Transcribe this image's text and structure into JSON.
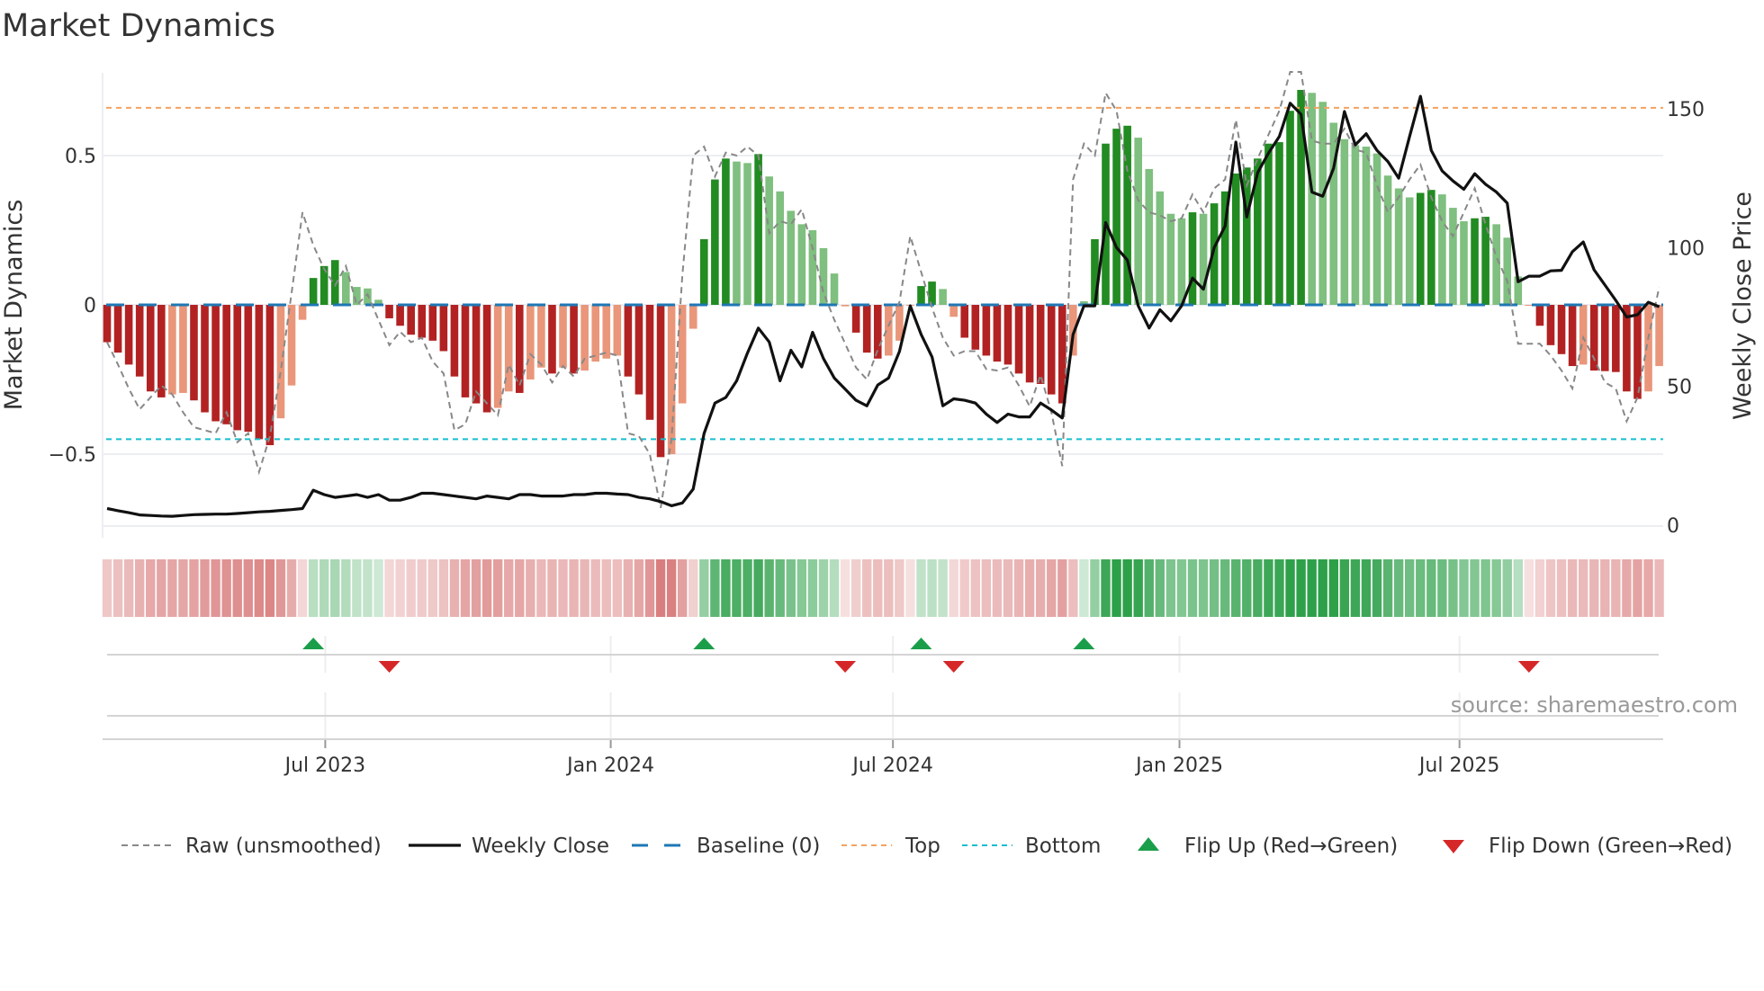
{
  "chart_data": {
    "type": "bar",
    "title": "Market Dynamics",
    "ylabel_left": "Market Dynamics",
    "ylabel_right": "Weekly Close Price",
    "source": "source: sharemaestro.com",
    "ylim_left": [
      -0.75,
      0.78
    ],
    "ylim_right": [
      0,
      160
    ],
    "left_ticks": [
      {
        "value": 0.5,
        "label": "0.5"
      },
      {
        "value": 0,
        "label": "0"
      },
      {
        "value": -0.5,
        "label": "−0.5"
      }
    ],
    "right_ticks": [
      {
        "value": 150,
        "label": "150"
      },
      {
        "value": 100,
        "label": "100"
      },
      {
        "value": 50,
        "label": "50"
      },
      {
        "value": 0,
        "label": "0"
      }
    ],
    "x_ticks": [
      {
        "week": 20.1,
        "label": "Jul 2023"
      },
      {
        "week": 46.4,
        "label": "Jan 2024"
      },
      {
        "week": 72.4,
        "label": "Jul 2024"
      },
      {
        "week": 98.8,
        "label": "Jan 2025"
      },
      {
        "week": 124.6,
        "label": "Jul 2025"
      }
    ],
    "top_level": 0.66,
    "bottom_level": -0.45,
    "baseline": 0,
    "colors": {
      "green_strong": "#228b22",
      "green_weak": "#7fbf7f",
      "red_strong": "#b22222",
      "red_weak": "#e9967a",
      "close": "#111111",
      "raw": "#888888",
      "baseline": "#1f77b4",
      "top": "#f4a261",
      "bottom": "#17becf",
      "flip_up": "#1a9e4a",
      "flip_down": "#d62728"
    },
    "dynamics": [
      -0.125,
      -0.16,
      -0.2,
      -0.24,
      -0.29,
      -0.31,
      -0.3,
      -0.295,
      -0.32,
      -0.36,
      -0.39,
      -0.4,
      -0.42,
      -0.425,
      -0.45,
      -0.47,
      -0.38,
      -0.27,
      -0.05,
      0.09,
      0.13,
      0.15,
      0.11,
      0.06,
      0.055,
      0.017,
      -0.045,
      -0.07,
      -0.1,
      -0.11,
      -0.12,
      -0.155,
      -0.24,
      -0.31,
      -0.33,
      -0.36,
      -0.345,
      -0.29,
      -0.295,
      -0.25,
      -0.21,
      -0.23,
      -0.21,
      -0.23,
      -0.22,
      -0.19,
      -0.18,
      -0.17,
      -0.24,
      -0.3,
      -0.385,
      -0.51,
      -0.5,
      -0.33,
      -0.08,
      0.22,
      0.42,
      0.49,
      0.48,
      0.475,
      0.505,
      0.43,
      0.38,
      0.315,
      0.27,
      0.25,
      0.19,
      0.105,
      -0.005,
      -0.093,
      -0.16,
      -0.18,
      -0.17,
      -0.12,
      -0.003,
      0.063,
      0.078,
      0.053,
      -0.04,
      -0.11,
      -0.15,
      -0.17,
      -0.19,
      -0.2,
      -0.23,
      -0.26,
      -0.265,
      -0.3,
      -0.33,
      -0.17,
      0.012,
      0.22,
      0.54,
      0.59,
      0.6,
      0.56,
      0.455,
      0.38,
      0.305,
      0.29,
      0.31,
      0.305,
      0.34,
      0.38,
      0.44,
      0.46,
      0.49,
      0.54,
      0.545,
      0.65,
      0.72,
      0.71,
      0.68,
      0.61,
      0.555,
      0.535,
      0.53,
      0.507,
      0.433,
      0.39,
      0.36,
      0.375,
      0.385,
      0.37,
      0.325,
      0.28,
      0.29,
      0.295,
      0.27,
      0.225,
      0.095,
      -0.003,
      -0.07,
      -0.135,
      -0.165,
      -0.205,
      -0.2,
      -0.22,
      -0.222,
      -0.225,
      -0.29,
      -0.315,
      -0.29,
      -0.205
    ],
    "raw": [
      -0.125,
      -0.2,
      -0.28,
      -0.35,
      -0.31,
      -0.27,
      -0.3,
      -0.36,
      -0.41,
      -0.42,
      -0.43,
      -0.36,
      -0.46,
      -0.43,
      -0.56,
      -0.44,
      -0.22,
      0.04,
      0.31,
      0.2,
      0.12,
      0.065,
      0.13,
      0.0,
      0.035,
      -0.05,
      -0.135,
      -0.09,
      -0.125,
      -0.11,
      -0.19,
      -0.23,
      -0.42,
      -0.4,
      -0.29,
      -0.33,
      -0.37,
      -0.2,
      -0.27,
      -0.165,
      -0.2,
      -0.26,
      -0.205,
      -0.24,
      -0.18,
      -0.17,
      -0.16,
      -0.17,
      -0.43,
      -0.44,
      -0.5,
      -0.68,
      -0.45,
      0.1,
      0.5,
      0.53,
      0.43,
      0.51,
      0.5,
      0.53,
      0.5,
      0.24,
      0.28,
      0.27,
      0.32,
      0.19,
      0.04,
      -0.05,
      -0.13,
      -0.21,
      -0.25,
      -0.15,
      -0.07,
      0.01,
      0.23,
      0.11,
      -0.01,
      -0.11,
      -0.17,
      -0.155,
      -0.155,
      -0.215,
      -0.22,
      -0.21,
      -0.27,
      -0.34,
      -0.235,
      -0.36,
      -0.54,
      0.42,
      0.54,
      0.5,
      0.71,
      0.65,
      0.45,
      0.35,
      0.31,
      0.3,
      0.28,
      0.29,
      0.37,
      0.31,
      0.39,
      0.42,
      0.62,
      0.4,
      0.49,
      0.57,
      0.65,
      0.78,
      0.79,
      0.55,
      0.54,
      0.54,
      0.59,
      0.52,
      0.51,
      0.4,
      0.31,
      0.36,
      0.42,
      0.47,
      0.36,
      0.28,
      0.23,
      0.31,
      0.39,
      0.27,
      0.16,
      0.08,
      -0.13,
      -0.13,
      -0.13,
      -0.17,
      -0.22,
      -0.28,
      -0.11,
      -0.18,
      -0.26,
      -0.28,
      -0.39,
      -0.31,
      -0.11,
      0.06
    ],
    "close": [
      6,
      5.2,
      4.5,
      3.7,
      3.5,
      3.3,
      3.2,
      3.5,
      3.8,
      3.9,
      4,
      4,
      4.2,
      4.5,
      4.8,
      5,
      5.3,
      5.6,
      6,
      12.6,
      11,
      10,
      10.5,
      11,
      10,
      11,
      9,
      9,
      10,
      11.5,
      11.5,
      11,
      10.5,
      10,
      9.5,
      10.5,
      10,
      9.5,
      11,
      11,
      10.5,
      10.5,
      10.5,
      11,
      11,
      11.5,
      11.5,
      11.2,
      11,
      10,
      9.5,
      8.5,
      7,
      8,
      13,
      33,
      44,
      46,
      52,
      62,
      71,
      66,
      52,
      63,
      57,
      69.5,
      60,
      53,
      49,
      45,
      43,
      50.5,
      53,
      62.6,
      79,
      68.7,
      60.6,
      43,
      45.5,
      45,
      44,
      40,
      37,
      40,
      39,
      39,
      44,
      41.5,
      38.6,
      68.7,
      79,
      79,
      109,
      100,
      95.5,
      79,
      71,
      77.6,
      73.6,
      79,
      89,
      85,
      100,
      107.7,
      138,
      111,
      127,
      134,
      140,
      152,
      148,
      120,
      118.5,
      128.6,
      149,
      137,
      141,
      135,
      131,
      125,
      140,
      154.5,
      135,
      127.6,
      124,
      121,
      126.6,
      122.8,
      120,
      116,
      87.7,
      89.7,
      89.7,
      91.6,
      91.8,
      98.5,
      102,
      92,
      86.5,
      81,
      75,
      75.8,
      80.3,
      78.7
    ],
    "flips_up": [
      19,
      55,
      75,
      90
    ],
    "flips_down": [
      26,
      68,
      78,
      131
    ],
    "legend": [
      {
        "label": "Raw (unsmoothed)",
        "kind": "raw"
      },
      {
        "label": "Weekly Close",
        "kind": "close"
      },
      {
        "label": "Baseline (0)",
        "kind": "baseline"
      },
      {
        "label": "Top",
        "kind": "top"
      },
      {
        "label": "Bottom",
        "kind": "bottom"
      },
      {
        "label": "Flip Up (Red→Green)",
        "kind": "up"
      },
      {
        "label": "Flip Down (Green→Red)",
        "kind": "down"
      }
    ]
  }
}
